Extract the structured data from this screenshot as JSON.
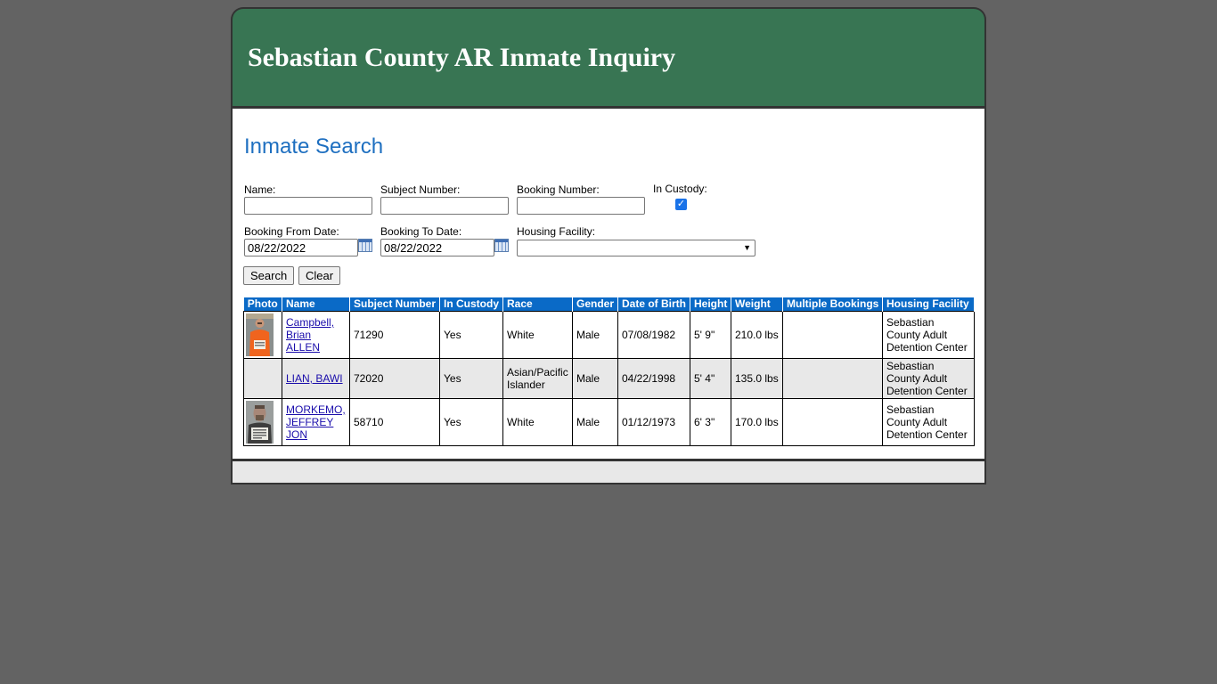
{
  "header": {
    "title": "Sebastian County AR Inmate Inquiry"
  },
  "search": {
    "heading": "Inmate Search",
    "name_label": "Name:",
    "name_value": "",
    "subject_label": "Subject Number:",
    "subject_value": "",
    "booking_label": "Booking Number:",
    "booking_value": "",
    "custody_label": "In Custody:",
    "custody_checked": true,
    "from_label": "Booking From Date:",
    "from_value": "08/22/2022",
    "to_label": "Booking To Date:",
    "to_value": "08/22/2022",
    "housing_label": "Housing Facility:",
    "housing_value": "",
    "search_button": "Search",
    "clear_button": "Clear"
  },
  "table": {
    "headers": [
      "Photo",
      "Name",
      "Subject Number",
      "In Custody",
      "Race",
      "Gender",
      "Date of Birth",
      "Height",
      "Weight",
      "Multiple Bookings",
      "Housing Facility"
    ],
    "rows": [
      {
        "photo": "orange-jumpsuit",
        "name": "Campbell, Brian ALLEN",
        "subject": "71290",
        "custody": "Yes",
        "race": "White",
        "gender": "Male",
        "dob": "07/08/1982",
        "height": "5' 9\"",
        "weight": "210.0 lbs",
        "multiple": "",
        "facility": "Sebastian County Adult Detention Center"
      },
      {
        "photo": "",
        "name": "LIAN, BAWI",
        "subject": "72020",
        "custody": "Yes",
        "race": "Asian/Pacific Islander",
        "gender": "Male",
        "dob": "04/22/1998",
        "height": "5' 4\"",
        "weight": "135.0 lbs",
        "multiple": "",
        "facility": "Sebastian County Adult Detention Center"
      },
      {
        "photo": "placard",
        "name": "MORKEMO, JEFFREY JON",
        "subject": "58710",
        "custody": "Yes",
        "race": "White",
        "gender": "Male",
        "dob": "01/12/1973",
        "height": "6' 3\"",
        "weight": "170.0 lbs",
        "multiple": "",
        "facility": "Sebastian County Adult Detention Center"
      }
    ]
  },
  "colors": {
    "header_bg": "#387553",
    "heading": "#1e6fc0",
    "table_header": "#0a6ac7",
    "page_bg": "#636363"
  }
}
